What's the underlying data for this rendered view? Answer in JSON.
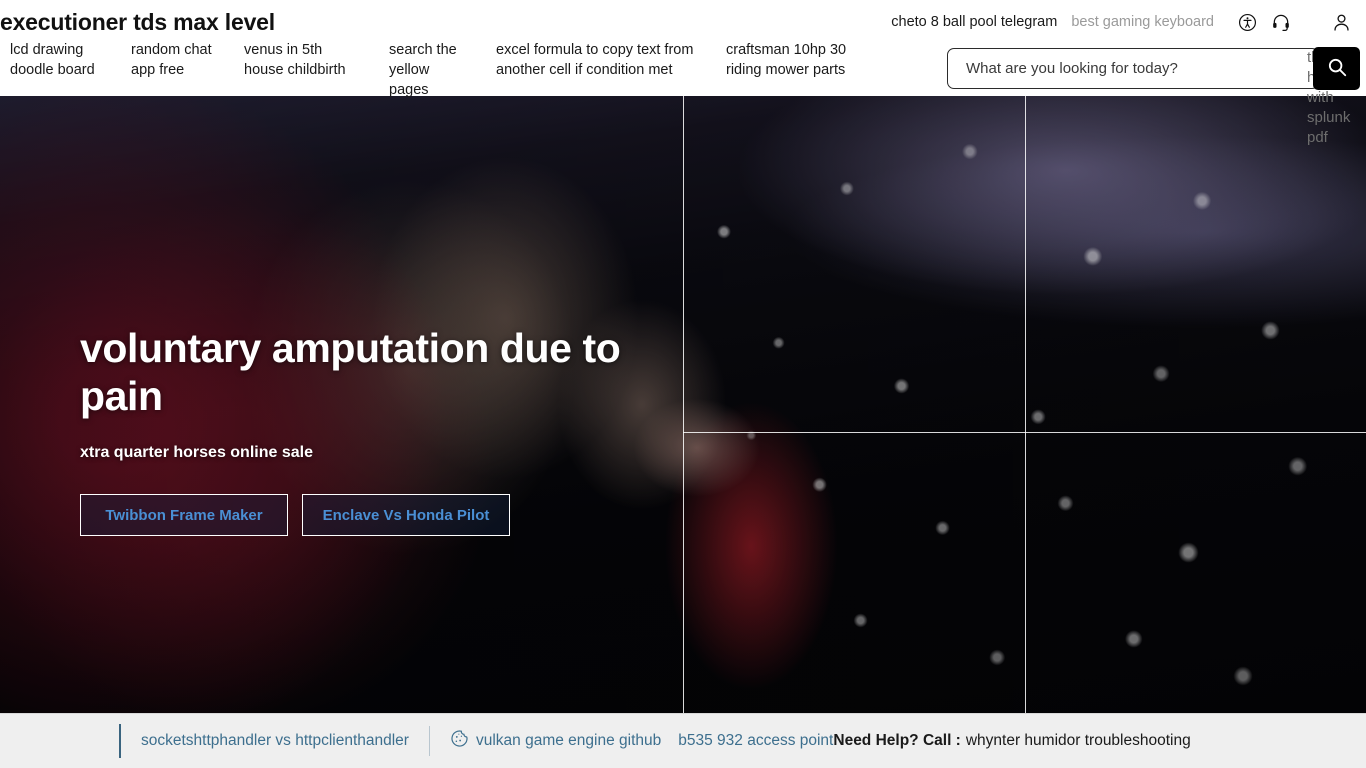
{
  "header": {
    "brand_title": "executioner tds max level",
    "utility_links": [
      {
        "label": "cheto 8 ball pool telegram",
        "muted": false
      },
      {
        "label": "best gaming keyboard",
        "muted": true
      }
    ],
    "icons": [
      {
        "name": "accessibility-icon"
      },
      {
        "name": "headset-icon"
      },
      {
        "name": "account-icon"
      }
    ],
    "nav_items": [
      "lcd drawing doodle board",
      "random chat app free",
      "venus in 5th house childbirth",
      "search the yellow pages",
      "excel formula to copy text from another cell if condition met",
      "craftsman 10hp 30 riding mower parts"
    ],
    "search": {
      "placeholder": "What are you looking for today?",
      "value": "",
      "button_icon": "search-icon",
      "overlap_text": "threat hunting with splunk pdf"
    }
  },
  "hero": {
    "title": "voluntary amputation due to pain",
    "subtitle": "xtra quarter horses online sale",
    "ctas": [
      "Twibbon Frame Maker",
      "Enclave Vs Honda Pilot"
    ]
  },
  "footer": {
    "link_primary": "socketshttphandler vs httpclienthandler",
    "cookie_icon": "cookie-icon",
    "link_cookie": "vulkan game engine github",
    "link_access_point": "b535 932 access point",
    "need_help_label": "Need Help? Call :",
    "need_help_value": "whynter humidor troubleshooting"
  },
  "colors": {
    "accent_blue": "#3d6f8e",
    "cta_text": "#4a8fd4",
    "footer_bg": "#efefef",
    "search_button_bg": "#000000"
  }
}
